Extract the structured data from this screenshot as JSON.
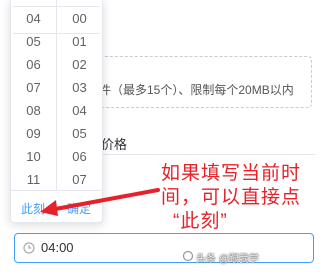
{
  "form": {
    "upload_tip": "件（最多15个）、限制每个20MB以内",
    "price_label": "价格"
  },
  "time_picker": {
    "hours": [
      "04",
      "05",
      "06",
      "07",
      "08",
      "09",
      "10",
      "11"
    ],
    "minutes": [
      "00",
      "01",
      "02",
      "03",
      "04",
      "05",
      "06",
      "07"
    ],
    "now_button": "此刻",
    "confirm_button": "确定"
  },
  "time_input": {
    "value": "04:00",
    "icon": "clock-icon"
  },
  "annotation": {
    "line1": "如果填写当前时",
    "line2": "间，可以直接点",
    "line3": "“此刻”",
    "color": "#e6212a"
  },
  "watermark": {
    "text": "头条 @跟我学"
  },
  "colors": {
    "accent": "#409eff",
    "annotation": "#e6212a"
  }
}
